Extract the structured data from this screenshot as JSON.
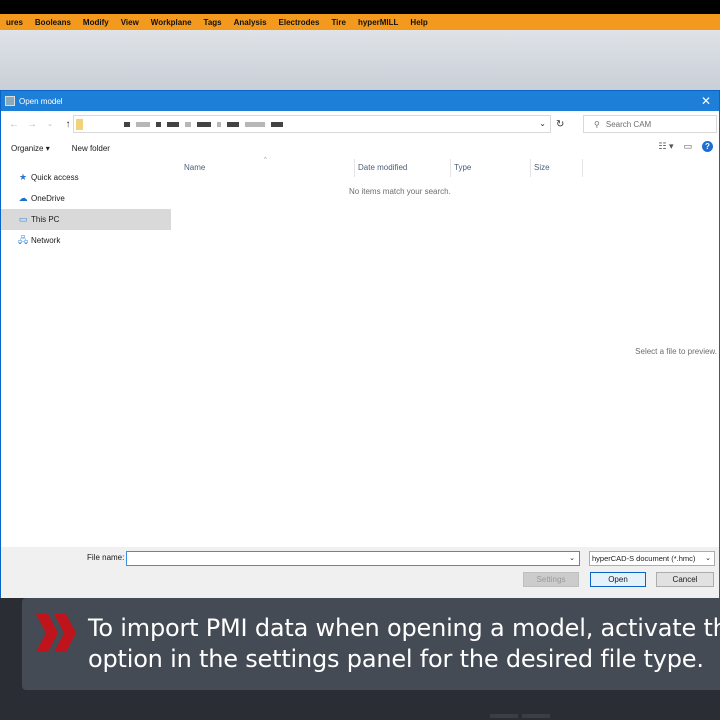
{
  "menubar": {
    "items": [
      "ures",
      "Booleans",
      "Modify",
      "View",
      "Workplane",
      "Tags",
      "Analysis",
      "Electrodes",
      "Tire",
      "hyperMILL",
      "Help"
    ]
  },
  "dialog": {
    "title": "Open model",
    "search_placeholder": "Search CAM",
    "toolbar": {
      "organize": "Organize",
      "new_folder": "New folder"
    },
    "nav": [
      {
        "label": "Quick access",
        "icon": "star-icon"
      },
      {
        "label": "OneDrive",
        "icon": "cloud-icon"
      },
      {
        "label": "This PC",
        "icon": "computer-icon",
        "selected": true
      },
      {
        "label": "Network",
        "icon": "network-icon"
      }
    ],
    "columns": {
      "name": "Name",
      "date": "Date modified",
      "type": "Type",
      "size": "Size"
    },
    "empty_message": "No items match your search.",
    "preview_message": "Select a file to preview.",
    "file_name_label": "File name:",
    "file_name_value": "",
    "file_type": "hyperCAD-S document (*.hmc)",
    "buttons": {
      "settings": "Settings",
      "open": "Open",
      "cancel": "Cancel"
    }
  },
  "caption": {
    "line1": "To import PMI data when opening a model, activate the",
    "line2": "option in the settings panel for the desired file type."
  },
  "colors": {
    "accent": "#1e7fd8",
    "menubar": "#f39a1e",
    "caption_arrow": "#c0141c"
  }
}
